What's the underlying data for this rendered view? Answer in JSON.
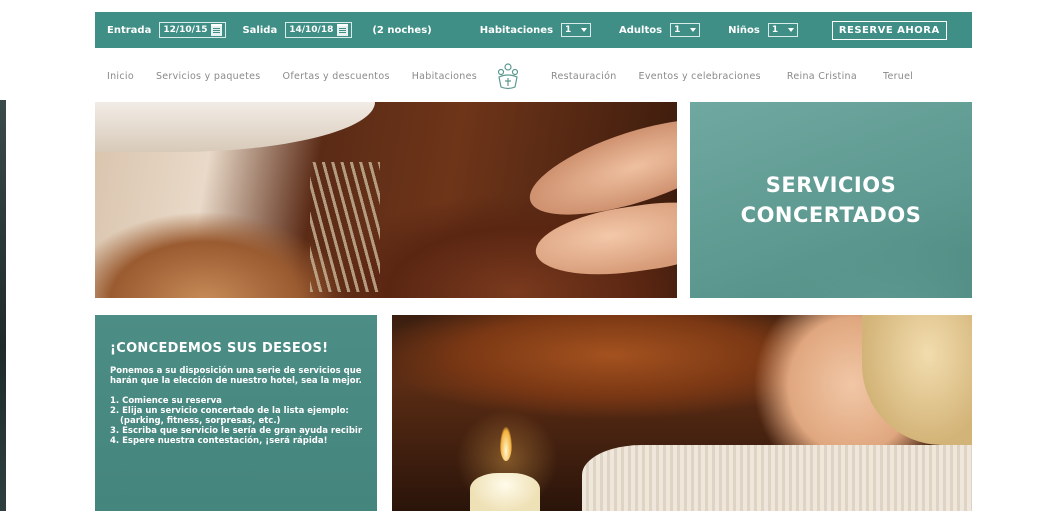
{
  "booking": {
    "checkin_label": "Entrada",
    "checkin_value": "12/10/15",
    "checkout_label": "Salida",
    "checkout_value": "14/10/18",
    "nights": "(2 noches)",
    "rooms_label": "Habitaciones",
    "rooms_value": "1",
    "adults_label": "Adultos",
    "adults_value": "1",
    "children_label": "Niños",
    "children_value": "1",
    "reserve_label": "RESERVE AHORA"
  },
  "nav": {
    "items_left": [
      "Inicio",
      "Servicios y paquetes",
      "Ofertas y descuentos",
      "Habitaciones"
    ],
    "items_right": [
      "Restauración",
      "Eventos y celebraciones",
      "Reina Cristina",
      "Teruel"
    ]
  },
  "panel_services": {
    "title_line1": "SERVICIOS",
    "title_line2": "CONCERTADOS"
  },
  "panel_wishes": {
    "title": "¡CONCEDEMOS SUS DESEOS!",
    "intro": "Ponemos a su disposición una serie de servicios que harán que la elección de nuestro hotel, sea la mejor.",
    "steps": [
      "1. Comience su reserva",
      "2. Elija un servicio concertado de la lista ejemplo: (parking, fitness, sorpresas, etc.)",
      "3. Escriba que servicio le sería de gran ayuda recibir",
      "4. Espere nuestra contestación, ¡será rápida!"
    ]
  },
  "colors": {
    "teal_bar": "#3f8f86",
    "teal_panel": "#5d9990",
    "teal_panel_dark": "#4c8d85",
    "nav_text": "#8a8a8a"
  },
  "icons": [
    "calendar-icon",
    "hotel-logo-icon",
    "chevron-down-icon"
  ]
}
